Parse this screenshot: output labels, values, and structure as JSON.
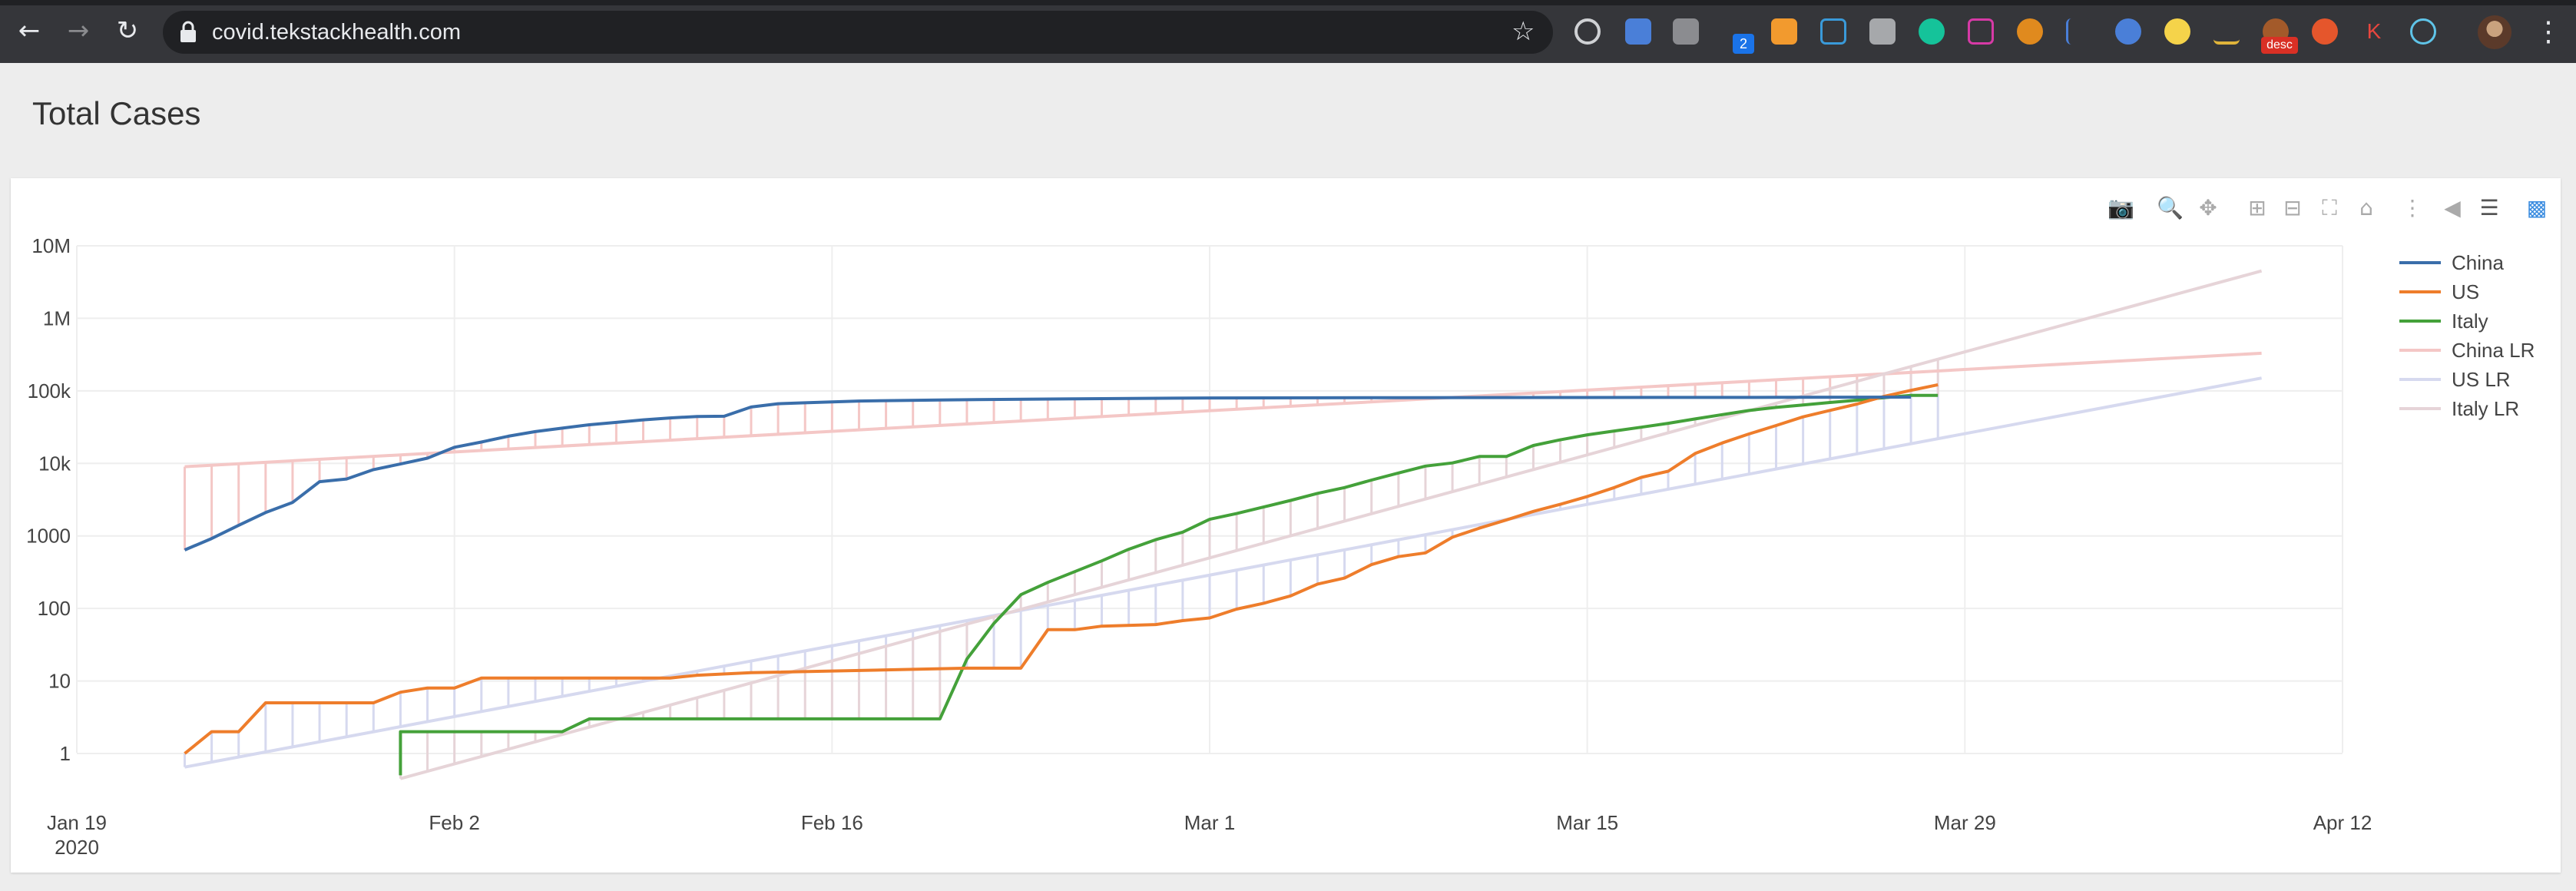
{
  "browser": {
    "url": "covid.tekstackhealth.com",
    "extension_badge_count": "2",
    "extension_desc_badge": "desc",
    "extension_k_letter": "K"
  },
  "page": {
    "title": "Total Cases"
  },
  "colors": {
    "china": "#3a6eaa",
    "us": "#ee7d2b",
    "italy": "#44a13a",
    "china_lr": "#f4c7c6",
    "us_lr": "#d6d9ef",
    "italy_lr": "#e6d4d8"
  },
  "modebar_icons": [
    "camera-icon",
    "zoom-icon",
    "pan-icon",
    "zoom-in-icon",
    "zoom-out-icon",
    "autoscale-icon",
    "reset-axes-icon",
    "spike-lines-icon",
    "hover-closest-icon",
    "hover-compare-icon",
    "plotly-logo-icon"
  ],
  "chart_data": {
    "type": "line",
    "title": "",
    "xlabel": "",
    "ylabel": "",
    "y_scale": "log",
    "x_ticks": [
      "Jan 19\n2020",
      "Feb 2",
      "Feb 16",
      "Mar 1",
      "Mar 15",
      "Mar 29",
      "Apr 12"
    ],
    "y_ticks": [
      "1",
      "10",
      "100",
      "1000",
      "10k",
      "100k",
      "1M",
      "10M"
    ],
    "xlim": [
      "2020-01-19",
      "2020-04-12"
    ],
    "ylim": [
      0.5,
      12000000
    ],
    "grid": true,
    "legend_position": "right",
    "series": [
      {
        "name": "China",
        "points": [
          [
            "2020-01-23",
            640
          ],
          [
            "2020-01-24",
            920
          ],
          [
            "2020-01-25",
            1400
          ],
          [
            "2020-01-26",
            2100
          ],
          [
            "2020-01-27",
            2900
          ],
          [
            "2020-01-28",
            5600
          ],
          [
            "2020-01-29",
            6100
          ],
          [
            "2020-01-30",
            8200
          ],
          [
            "2020-01-31",
            9800
          ],
          [
            "2020-02-01",
            11800
          ],
          [
            "2020-02-02",
            16700
          ],
          [
            "2020-02-03",
            19700
          ],
          [
            "2020-02-04",
            23700
          ],
          [
            "2020-02-05",
            27400
          ],
          [
            "2020-02-06",
            30600
          ],
          [
            "2020-02-07",
            34100
          ],
          [
            "2020-02-08",
            36800
          ],
          [
            "2020-02-09",
            39800
          ],
          [
            "2020-02-10",
            42300
          ],
          [
            "2020-02-11",
            44300
          ],
          [
            "2020-02-12",
            44700
          ],
          [
            "2020-02-13",
            59900
          ],
          [
            "2020-02-14",
            66400
          ],
          [
            "2020-02-15",
            68400
          ],
          [
            "2020-02-17",
            72400
          ],
          [
            "2020-02-20",
            75000
          ],
          [
            "2020-02-25",
            77700
          ],
          [
            "2020-03-01",
            79900
          ],
          [
            "2020-03-08",
            80700
          ],
          [
            "2020-03-15",
            81000
          ],
          [
            "2020-03-22",
            81400
          ],
          [
            "2020-03-27",
            81900
          ]
        ]
      },
      {
        "name": "US",
        "points": [
          [
            "2020-01-23",
            1
          ],
          [
            "2020-01-24",
            2
          ],
          [
            "2020-01-25",
            2
          ],
          [
            "2020-01-26",
            5
          ],
          [
            "2020-01-30",
            5
          ],
          [
            "2020-01-31",
            7
          ],
          [
            "2020-02-01",
            8
          ],
          [
            "2020-02-02",
            8
          ],
          [
            "2020-02-03",
            11
          ],
          [
            "2020-02-10",
            11
          ],
          [
            "2020-02-11",
            12
          ],
          [
            "2020-02-13",
            13
          ],
          [
            "2020-02-21",
            15
          ],
          [
            "2020-02-23",
            15
          ],
          [
            "2020-02-24",
            51
          ],
          [
            "2020-02-25",
            51
          ],
          [
            "2020-02-26",
            57
          ],
          [
            "2020-02-28",
            60
          ],
          [
            "2020-02-29",
            68
          ],
          [
            "2020-03-01",
            74
          ],
          [
            "2020-03-02",
            98
          ],
          [
            "2020-03-03",
            118
          ],
          [
            "2020-03-04",
            149
          ],
          [
            "2020-03-05",
            217
          ],
          [
            "2020-03-06",
            262
          ],
          [
            "2020-03-07",
            402
          ],
          [
            "2020-03-08",
            518
          ],
          [
            "2020-03-09",
            583
          ],
          [
            "2020-03-10",
            959
          ],
          [
            "2020-03-11",
            1281
          ],
          [
            "2020-03-12",
            1663
          ],
          [
            "2020-03-13",
            2179
          ],
          [
            "2020-03-14",
            2727
          ],
          [
            "2020-03-15",
            3499
          ],
          [
            "2020-03-16",
            4632
          ],
          [
            "2020-03-17",
            6421
          ],
          [
            "2020-03-18",
            7786
          ],
          [
            "2020-03-19",
            13680
          ],
          [
            "2020-03-20",
            19101
          ],
          [
            "2020-03-21",
            25493
          ],
          [
            "2020-03-22",
            33276
          ],
          [
            "2020-03-23",
            43847
          ],
          [
            "2020-03-24",
            53740
          ],
          [
            "2020-03-25",
            65778
          ],
          [
            "2020-03-26",
            83836
          ],
          [
            "2020-03-27",
            101657
          ],
          [
            "2020-03-28",
            121478
          ]
        ]
      },
      {
        "name": "Italy",
        "points": [
          [
            "2020-01-31",
            0.5
          ],
          [
            "2020-01-31",
            2
          ],
          [
            "2020-02-06",
            2
          ],
          [
            "2020-02-07",
            3
          ],
          [
            "2020-02-20",
            3
          ],
          [
            "2020-02-21",
            20
          ],
          [
            "2020-02-22",
            62
          ],
          [
            "2020-02-23",
            155
          ],
          [
            "2020-02-24",
            229
          ],
          [
            "2020-02-25",
            322
          ],
          [
            "2020-02-26",
            453
          ],
          [
            "2020-02-27",
            655
          ],
          [
            "2020-02-28",
            888
          ],
          [
            "2020-02-29",
            1128
          ],
          [
            "2020-03-01",
            1694
          ],
          [
            "2020-03-02",
            2036
          ],
          [
            "2020-03-03",
            2502
          ],
          [
            "2020-03-04",
            3089
          ],
          [
            "2020-03-05",
            3858
          ],
          [
            "2020-03-06",
            4636
          ],
          [
            "2020-03-07",
            5883
          ],
          [
            "2020-03-08",
            7375
          ],
          [
            "2020-03-09",
            9172
          ],
          [
            "2020-03-10",
            10149
          ],
          [
            "2020-03-11",
            12462
          ],
          [
            "2020-03-12",
            12462
          ],
          [
            "2020-03-13",
            17660
          ],
          [
            "2020-03-14",
            21157
          ],
          [
            "2020-03-15",
            24747
          ],
          [
            "2020-03-16",
            27980
          ],
          [
            "2020-03-17",
            31506
          ],
          [
            "2020-03-18",
            35713
          ],
          [
            "2020-03-19",
            41035
          ],
          [
            "2020-03-20",
            47021
          ],
          [
            "2020-03-21",
            53578
          ],
          [
            "2020-03-22",
            59138
          ],
          [
            "2020-03-23",
            63927
          ],
          [
            "2020-03-24",
            69176
          ],
          [
            "2020-03-25",
            74386
          ],
          [
            "2020-03-26",
            80589
          ],
          [
            "2020-03-27",
            86498
          ],
          [
            "2020-03-28",
            86498
          ]
        ]
      },
      {
        "name": "China LR",
        "points": [
          [
            "2020-01-23",
            9000
          ],
          [
            "2020-04-09",
            330000
          ]
        ]
      },
      {
        "name": "US LR",
        "points": [
          [
            "2020-01-23",
            0.65
          ],
          [
            "2020-04-09",
            150000
          ]
        ]
      },
      {
        "name": "Italy LR",
        "points": [
          [
            "2020-01-31",
            0.45
          ],
          [
            "2020-04-09",
            4500000
          ]
        ]
      }
    ]
  }
}
